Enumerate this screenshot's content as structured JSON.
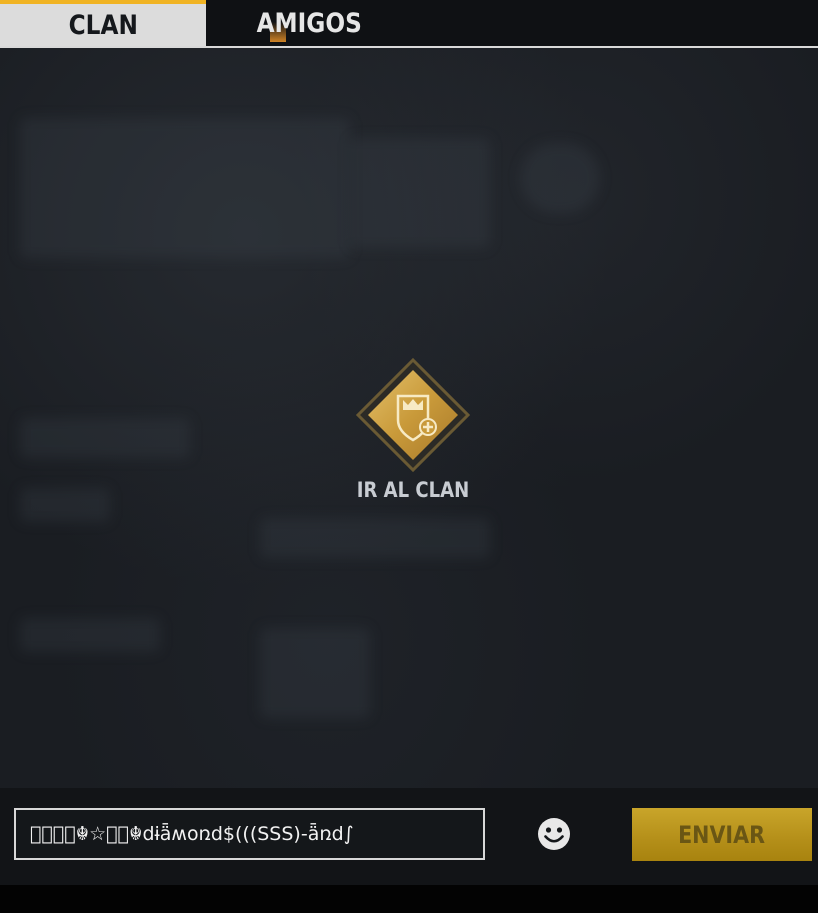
{
  "tabs": [
    {
      "label": "CLAN",
      "active": true
    },
    {
      "label": "AMIGOS",
      "active": false
    }
  ],
  "clan": {
    "go_label": "IR AL CLAN",
    "emblem_icon": "clan-shield-add-icon"
  },
  "chat": {
    "input_value": "ꦿ⃟ঔ⃟☬☆⃟⍭☬dɨǟʍօռd$(((SSS)-ǟռd∫",
    "emoji_icon": "smiley-face-icon",
    "send_label": "ENVIAR"
  },
  "colors": {
    "accent": "#f0b323",
    "gold": "#c9a52a",
    "background": "#1a1d22"
  }
}
